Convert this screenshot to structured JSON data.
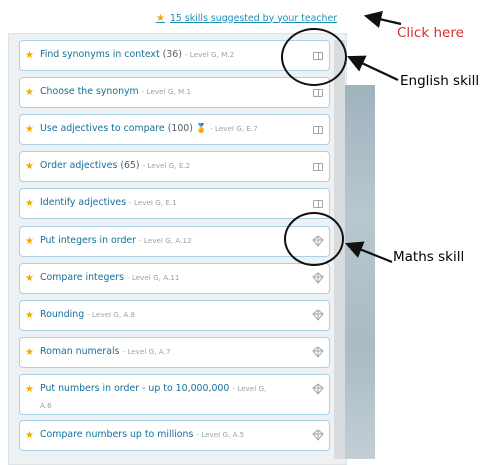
{
  "header": {
    "suggest_link": "15 skills suggested by your teacher"
  },
  "skills": [
    {
      "name": "Find synonyms in context",
      "count": "(36)",
      "level": "- Level G, M.2",
      "icon": "book-icon"
    },
    {
      "name": "Choose the synonym",
      "count": "",
      "level": "- Level G, M.1",
      "icon": "book-icon"
    },
    {
      "name": "Use adjectives to compare",
      "count": "(100)",
      "level": "- Level G, E.7",
      "icon": "book-icon",
      "medal": true
    },
    {
      "name": "Order adjectives",
      "count": "(65)",
      "level": "- Level G, E.2",
      "icon": "book-icon"
    },
    {
      "name": "Identify adjectives",
      "count": "",
      "level": "- Level G, E.1",
      "icon": "book-icon"
    },
    {
      "name": "Put integers in order",
      "count": "",
      "level": "- Level G, A.12",
      "icon": "abacus-icon"
    },
    {
      "name": "Compare integers",
      "count": "",
      "level": "- Level G, A.11",
      "icon": "abacus-icon"
    },
    {
      "name": "Rounding",
      "count": "",
      "level": "- Level G, A.8",
      "icon": "abacus-icon"
    },
    {
      "name": "Roman numerals",
      "count": "",
      "level": "- Level G, A.7",
      "icon": "abacus-icon"
    },
    {
      "name": "Put numbers in order - up to 10,000,000",
      "count": "",
      "level": "- Level G,",
      "level_line2": "A.6",
      "icon": "abacus-icon"
    },
    {
      "name": "Compare numbers up to millions",
      "count": "",
      "level": "- Level G, A.5",
      "icon": "abacus-icon"
    }
  ],
  "annotations": {
    "click_here": "Click here",
    "english_skill": "English skill",
    "maths_skill": "Maths skill"
  }
}
